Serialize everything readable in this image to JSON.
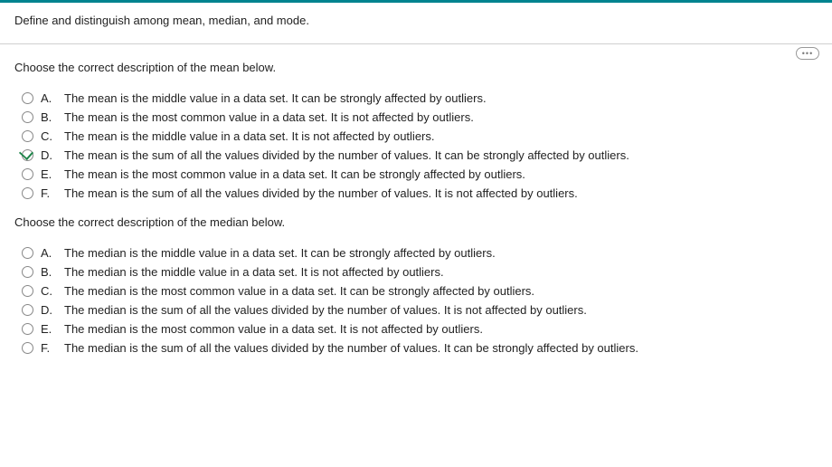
{
  "header": {
    "question": "Define and distinguish among mean, median, and mode."
  },
  "help_label": "•••",
  "part1": {
    "prompt": "Choose the correct description of the mean below.",
    "options": {
      "A": "The mean is the middle value in a data set. It can be strongly affected by outliers.",
      "B": "The mean is the most common value in a data set. It is not affected by outliers.",
      "C": "The mean is the middle value in a data set. It is not affected by outliers.",
      "D": "The mean is the sum of all the values divided by the number of values. It can be strongly affected by outliers.",
      "E": "The mean is the most common value in a data set. It can be strongly affected by outliers.",
      "F": "The mean is the sum of all the values divided by the number of values. It is not affected by outliers."
    },
    "letters": {
      "A": "A.",
      "B": "B.",
      "C": "C.",
      "D": "D.",
      "E": "E.",
      "F": "F."
    }
  },
  "part2": {
    "prompt": "Choose the correct description of the median below.",
    "options": {
      "A": "The median is the middle value in a data set. It can be strongly affected by outliers.",
      "B": "The median is the middle value in a data set. It is not affected by outliers.",
      "C": "The median is the most common value in a data set. It can be strongly affected by outliers.",
      "D": "The median is the sum of all the values divided by the number of values. It is not affected by outliers.",
      "E": "The median is the most common value in a data set. It is not affected by outliers.",
      "F": "The median is the sum of all the values divided by the number of values. It can be strongly affected by outliers."
    },
    "letters": {
      "A": "A.",
      "B": "B.",
      "C": "C.",
      "D": "D.",
      "E": "E.",
      "F": "F."
    }
  }
}
